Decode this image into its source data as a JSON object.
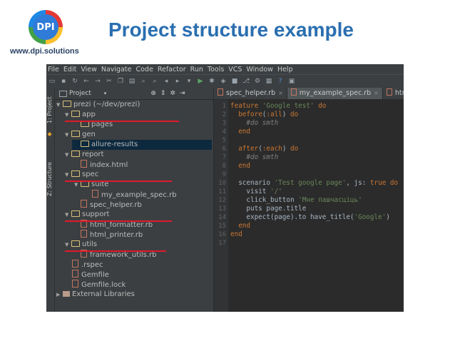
{
  "header": {
    "logo_text": "DPI",
    "url": "www.dpi.solutions",
    "title": "Project structure example"
  },
  "menu": [
    "File",
    "Edit",
    "View",
    "Navigate",
    "Code",
    "Refactor",
    "Run",
    "Tools",
    "VCS",
    "Window",
    "Help"
  ],
  "tool_strip": {
    "project": "1: Project",
    "structure": "Z: Structure"
  },
  "project_panel": {
    "label": "Project",
    "tree": [
      {
        "label": "prezi (~/dev/prezi)",
        "type": "folder",
        "depth": 0,
        "open": true
      },
      {
        "label": "app",
        "type": "folder",
        "depth": 1,
        "open": true
      },
      {
        "label": "pages",
        "type": "folder",
        "depth": 2
      },
      {
        "label": "gen",
        "type": "folder",
        "depth": 1,
        "open": true
      },
      {
        "label": "allure-results",
        "type": "folder",
        "depth": 2,
        "selected": true
      },
      {
        "label": "report",
        "type": "folder",
        "depth": 1,
        "open": true
      },
      {
        "label": "index.html",
        "type": "file",
        "depth": 2
      },
      {
        "label": "spec",
        "type": "folder",
        "depth": 1,
        "open": true
      },
      {
        "label": "suite",
        "type": "folder",
        "depth": 2,
        "open": true
      },
      {
        "label": "my_example_spec.rb",
        "type": "file",
        "depth": 3
      },
      {
        "label": "spec_helper.rb",
        "type": "file",
        "depth": 2
      },
      {
        "label": "support",
        "type": "folder",
        "depth": 1,
        "open": true
      },
      {
        "label": "html_formatter.rb",
        "type": "file",
        "depth": 2
      },
      {
        "label": "html_printer.rb",
        "type": "file",
        "depth": 2
      },
      {
        "label": "utils",
        "type": "folder",
        "depth": 1,
        "open": true
      },
      {
        "label": "framework_utils.rb",
        "type": "file",
        "depth": 2
      },
      {
        "label": ".rspec",
        "type": "file",
        "depth": 1
      },
      {
        "label": "Gemfile",
        "type": "file",
        "depth": 1
      },
      {
        "label": "Gemfile.lock",
        "type": "file",
        "depth": 1
      },
      {
        "label": "External Libraries",
        "type": "lib",
        "depth": 0
      }
    ]
  },
  "editor": {
    "tabs": [
      {
        "label": "spec_helper.rb",
        "active": false
      },
      {
        "label": "my_example_spec.rb",
        "active": true
      },
      {
        "label": "html_p",
        "active": false
      }
    ],
    "line_numbers": [
      "1",
      "2",
      "3",
      "4",
      "5",
      "6",
      "7",
      "8",
      "9",
      "10",
      "11",
      "12",
      "13",
      "14",
      "15",
      "16",
      "17"
    ]
  },
  "colors": {
    "accent_title": "#2a6fb0",
    "marker": "#e0192b",
    "ide_bg": "#2b2b2b"
  }
}
